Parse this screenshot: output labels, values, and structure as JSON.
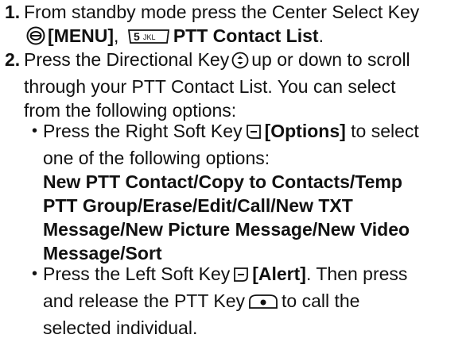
{
  "step1": {
    "num": "1.",
    "l1": "From standby mode press the Center Select Key",
    "l2_bold1": "[MENU]",
    "l2_comma": ",",
    "key5": "5JKL",
    "l2_bold2": "PTT Contact List",
    "l2_end": "."
  },
  "step2": {
    "num": "2.",
    "l1a": "Press the Directional Key",
    "l1b": "up or down to scroll",
    "l2": "through your PTT Contact List. You can select",
    "l3": "from the following options:"
  },
  "bullet1": {
    "dot": "•",
    "l1a": "Press the Right Soft Key",
    "l1b": "[Options]",
    "l1c": "to select",
    "l2": "one of the following options:",
    "opt1": "New PTT Contact/Copy to Contacts/Temp",
    "opt2": "PTT Group/Erase/Edit/Call/New TXT",
    "opt3": "Message/New Picture Message/New Video",
    "opt4": "Message/Sort"
  },
  "bullet2": {
    "dot": "•",
    "l1a": "Press the Left Soft Key",
    "l1b": "[Alert]",
    "l1c": ". Then press",
    "l2a": "and release the PTT Key",
    "l2b": "to call the",
    "l3": "selected individual."
  },
  "icons": [
    "center-select-key-icon",
    "key-5-icon",
    "directional-key-icon",
    "right-soft-key-icon",
    "left-soft-key-icon",
    "ptt-key-icon"
  ]
}
